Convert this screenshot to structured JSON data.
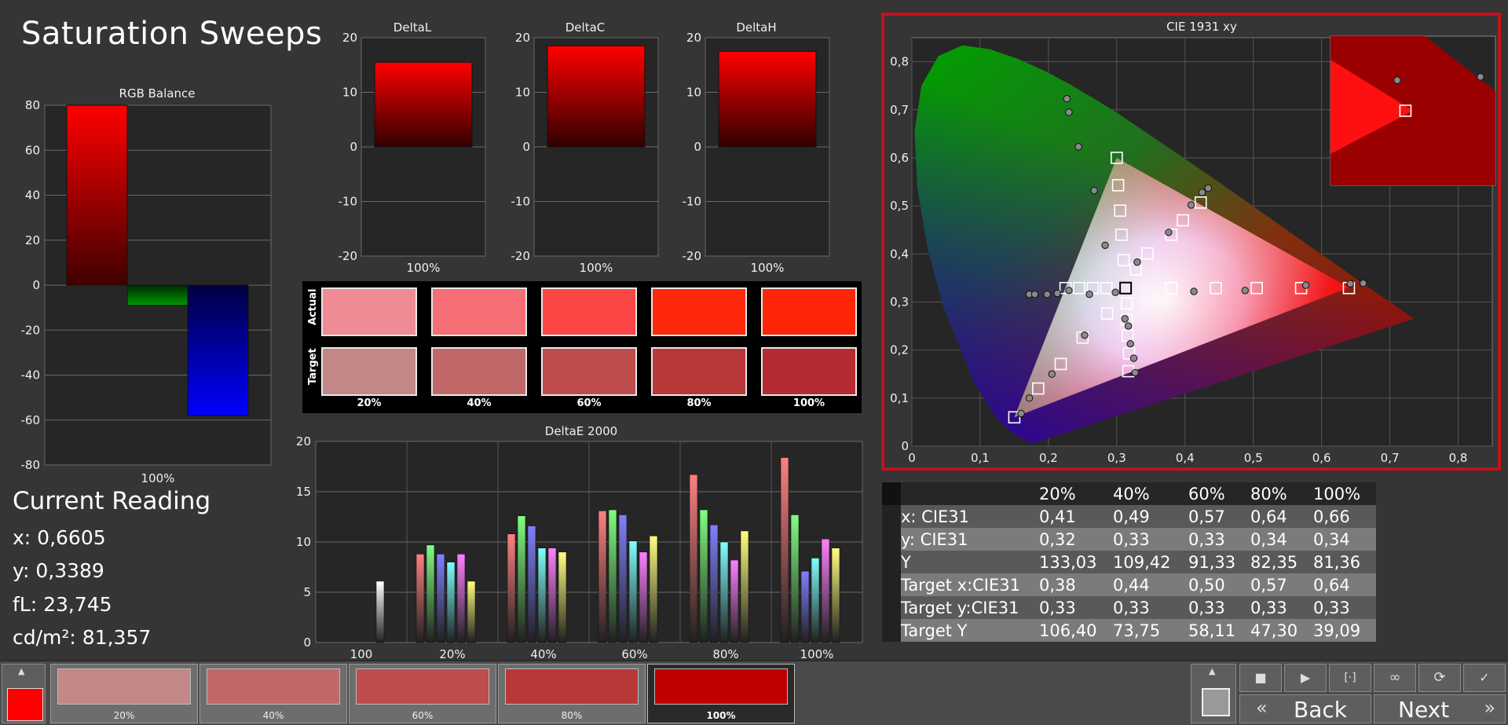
{
  "page_title": "Saturation Sweeps",
  "rgb_balance": {
    "title": "RGB Balance",
    "yticks": [
      "80",
      "60",
      "40",
      "20",
      "0",
      "-20",
      "-40",
      "-60",
      "-80"
    ],
    "xlabel": "100%",
    "values": [
      80,
      -9,
      -58
    ],
    "colors": [
      "#ff0000",
      "#009900",
      "#0000ff"
    ]
  },
  "delta_charts": [
    {
      "title": "DeltaL",
      "xlabel": "100%",
      "value": 15.5
    },
    {
      "title": "DeltaC",
      "xlabel": "100%",
      "value": 18.5
    },
    {
      "title": "DeltaH",
      "xlabel": "100%",
      "value": 17.5
    }
  ],
  "delta_yticks": [
    "20",
    "10",
    "0",
    "-10",
    "-20"
  ],
  "swatches": {
    "actual_label": "Actual",
    "target_label": "Target",
    "labels": [
      "20%",
      "40%",
      "60%",
      "80%",
      "100%"
    ],
    "actual": [
      "#ef8b94",
      "#f46e73",
      "#fb4645",
      "#ff2709",
      "#ff2507"
    ],
    "target": [
      "#c28786",
      "#c06868",
      "#bf4c4c",
      "#b83838",
      "#b42c32"
    ]
  },
  "deltae": {
    "title": "DeltaE 2000",
    "yticks": [
      "20",
      "15",
      "10",
      "5",
      "0"
    ],
    "categories": [
      "100",
      "20%",
      "40%",
      "60%",
      "80%",
      "100%"
    ],
    "bar_colors": [
      "#ff8080",
      "#80ff80",
      "#8080ff",
      "#80ffff",
      "#ff80ff",
      "#ffff80"
    ],
    "groups": [
      [
        0,
        0,
        0,
        0,
        0,
        6.1
      ],
      [
        8.8,
        9.7,
        8.8,
        8.0,
        8.8,
        6.1
      ],
      [
        10.8,
        12.6,
        11.6,
        9.4,
        9.4,
        9.0
      ],
      [
        13.1,
        13.2,
        12.7,
        10.1,
        9.0,
        10.6
      ],
      [
        16.7,
        13.2,
        11.7,
        10.0,
        8.2,
        11.1
      ],
      [
        18.4,
        12.7,
        7.1,
        8.4,
        10.3,
        9.4
      ]
    ]
  },
  "cie": {
    "title": "CIE 1931 xy",
    "xticks": [
      "0",
      "0,1",
      "0,2",
      "0,3",
      "0,4",
      "0,5",
      "0,6",
      "0,7",
      "0,8"
    ],
    "yticks": [
      "0,8",
      "0,7",
      "0,6",
      "0,5",
      "0,4",
      "0,3",
      "0,2",
      "0,1",
      "0"
    ],
    "targets": [
      [
        0.3,
        0.6
      ],
      [
        0.302,
        0.543
      ],
      [
        0.305,
        0.49
      ],
      [
        0.307,
        0.44
      ],
      [
        0.31,
        0.387
      ],
      [
        0.313,
        0.329
      ],
      [
        0.328,
        0.368
      ],
      [
        0.345,
        0.401
      ],
      [
        0.38,
        0.44
      ],
      [
        0.397,
        0.47
      ],
      [
        0.423,
        0.507
      ],
      [
        0.225,
        0.329
      ],
      [
        0.245,
        0.329
      ],
      [
        0.265,
        0.329
      ],
      [
        0.285,
        0.329
      ],
      [
        0.38,
        0.329
      ],
      [
        0.445,
        0.329
      ],
      [
        0.505,
        0.329
      ],
      [
        0.57,
        0.329
      ],
      [
        0.64,
        0.329
      ],
      [
        0.286,
        0.276
      ],
      [
        0.315,
        0.297
      ],
      [
        0.315,
        0.263
      ],
      [
        0.316,
        0.23
      ],
      [
        0.318,
        0.193
      ],
      [
        0.317,
        0.156
      ],
      [
        0.25,
        0.226
      ],
      [
        0.218,
        0.171
      ],
      [
        0.185,
        0.12
      ],
      [
        0.15,
        0.06
      ]
    ],
    "actual": [
      [
        0.227,
        0.723
      ],
      [
        0.23,
        0.695
      ],
      [
        0.244,
        0.623
      ],
      [
        0.267,
        0.532
      ],
      [
        0.283,
        0.418
      ],
      [
        0.33,
        0.383
      ],
      [
        0.376,
        0.445
      ],
      [
        0.409,
        0.502
      ],
      [
        0.425,
        0.528
      ],
      [
        0.434,
        0.537
      ],
      [
        0.172,
        0.316
      ],
      [
        0.18,
        0.316
      ],
      [
        0.198,
        0.316
      ],
      [
        0.213,
        0.318
      ],
      [
        0.23,
        0.324
      ],
      [
        0.26,
        0.316
      ],
      [
        0.298,
        0.32
      ],
      [
        0.413,
        0.322
      ],
      [
        0.488,
        0.324
      ],
      [
        0.577,
        0.335
      ],
      [
        0.642,
        0.338
      ],
      [
        0.661,
        0.339
      ],
      [
        0.312,
        0.265
      ],
      [
        0.317,
        0.25
      ],
      [
        0.32,
        0.213
      ],
      [
        0.325,
        0.183
      ],
      [
        0.327,
        0.153
      ],
      [
        0.253,
        0.231
      ],
      [
        0.205,
        0.15
      ],
      [
        0.172,
        0.1
      ],
      [
        0.16,
        0.068
      ]
    ],
    "inset_actual": [
      [
        0.709,
        0.735
      ],
      [
        0.82,
        0.74
      ]
    ],
    "inset_target": [
      [
        0.72,
        0.69
      ]
    ]
  },
  "current_reading": {
    "title": "Current Reading",
    "lines": [
      "x: 0,6605",
      "y: 0,3389",
      "fL: 23,745",
      "cd/m²: 81,357"
    ]
  },
  "table": {
    "headers": [
      "",
      "20%",
      "40%",
      "60%",
      "80%",
      "100%"
    ],
    "rows": [
      [
        "x: CIE31",
        "0,41",
        "0,49",
        "0,57",
        "0,64",
        "0,66"
      ],
      [
        "y: CIE31",
        "0,32",
        "0,33",
        "0,33",
        "0,34",
        "0,34"
      ],
      [
        "Y",
        "133,03",
        "109,42",
        "91,33",
        "82,35",
        "81,36"
      ],
      [
        "Target x:CIE31",
        "0,38",
        "0,44",
        "0,50",
        "0,57",
        "0,64"
      ],
      [
        "Target y:CIE31",
        "0,33",
        "0,33",
        "0,33",
        "0,33",
        "0,33"
      ],
      [
        "Target Y",
        "106,40",
        "73,75",
        "58,11",
        "47,30",
        "39,09"
      ]
    ]
  },
  "bottom": {
    "thumbs": [
      {
        "label": "20%",
        "color": "#c28786"
      },
      {
        "label": "40%",
        "color": "#c06868"
      },
      {
        "label": "60%",
        "color": "#bf4c4c"
      },
      {
        "label": "80%",
        "color": "#b83838"
      },
      {
        "label": "100%",
        "color": "#c00000"
      }
    ],
    "current_color": "#ff0000",
    "back_label": "Back",
    "next_label": "Next"
  }
}
